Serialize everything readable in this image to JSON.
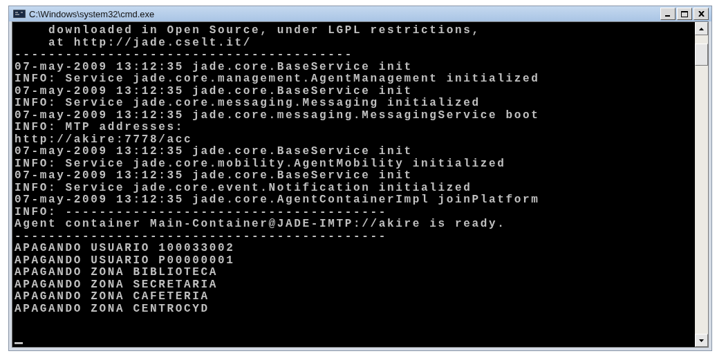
{
  "window": {
    "title": "C:\\Windows\\system32\\cmd.exe"
  },
  "console": {
    "lines": [
      {
        "text": "    downloaded in Open Source, under LGPL restrictions,"
      },
      {
        "text": "    at http://jade.cselt.it/"
      },
      {
        "text": "----------------------------------------"
      },
      {
        "text": "07-may-2009 13:12:35 jade.core.BaseService init"
      },
      {
        "text": "INFO: Service jade.core.management.AgentManagement initialized"
      },
      {
        "text": "07-may-2009 13:12:35 jade.core.BaseService init"
      },
      {
        "text": "INFO: Service jade.core.messaging.Messaging initialized"
      },
      {
        "text": "07-may-2009 13:12:35 jade.core.messaging.MessagingService boot"
      },
      {
        "text": "INFO: MTP addresses:"
      },
      {
        "text": "http://akire:7778/acc"
      },
      {
        "text": "07-may-2009 13:12:35 jade.core.BaseService init"
      },
      {
        "text": "INFO: Service jade.core.mobility.AgentMobility initialized"
      },
      {
        "text": "07-may-2009 13:12:35 jade.core.BaseService init"
      },
      {
        "text": "INFO: Service jade.core.event.Notification initialized"
      },
      {
        "text": "07-may-2009 13:12:35 jade.core.AgentContainerImpl joinPlatform"
      },
      {
        "text": "INFO: --------------------------------------"
      },
      {
        "text": "Agent container Main-Container@JADE-IMTP://akire is ready."
      },
      {
        "text": "--------------------------------------------"
      },
      {
        "text": "APAGANDO USUARIO 100033002"
      },
      {
        "text": "APAGANDO USUARIO P00000001"
      },
      {
        "text": "APAGANDO ZONA BIBLIOTECA"
      },
      {
        "text": "APAGANDO ZONA SECRETARIA"
      },
      {
        "text": "APAGANDO ZONA CAFETERIA"
      },
      {
        "text": "APAGANDO ZONA CENTROCYD"
      }
    ]
  }
}
